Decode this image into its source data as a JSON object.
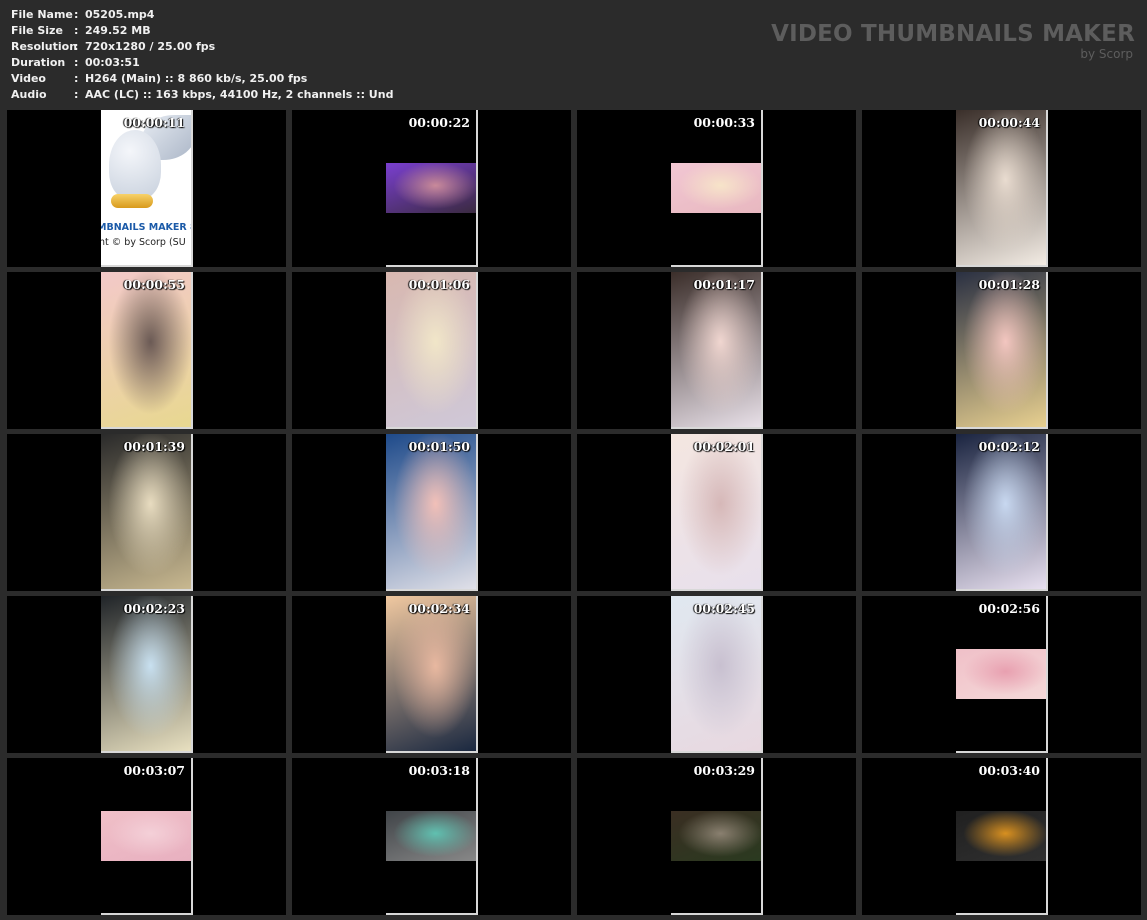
{
  "info": [
    {
      "key": "File Name",
      "value": "05205.mp4"
    },
    {
      "key": "File Size",
      "value": "249.52 MB"
    },
    {
      "key": "Resolution",
      "value": "720x1280 / 25.00 fps"
    },
    {
      "key": "Duration",
      "value": "00:03:51"
    },
    {
      "key": "Video",
      "value": "H264 (Main) :: 8 860 kb/s, 25.00 fps"
    },
    {
      "key": "Audio",
      "value": "AAC (LC) :: 163 kbps, 44100 Hz, 2 channels :: Und"
    }
  ],
  "separator": ":",
  "logo": {
    "title": "VIDEO THUMBNAILS MAKER",
    "subtitle": "by Scorp"
  },
  "owl_frame": {
    "line1": "MBNAILS MAKER 8",
    "line2": "nt © by Scorp (SU"
  },
  "thumbnails": [
    {
      "time": "00:00:11",
      "kind": "owl"
    },
    {
      "time": "00:00:22",
      "kind": "banner",
      "colors": [
        "#7a3fd0",
        "#c98a9a",
        "#3a2a40"
      ]
    },
    {
      "time": "00:00:33",
      "kind": "banner",
      "colors": [
        "#f2c7d3",
        "#f7e4c9",
        "#e8b8c0"
      ]
    },
    {
      "time": "00:00:44",
      "kind": "full",
      "colors": [
        "#3a2f2a",
        "#e9dcd0",
        "#f3ece4"
      ]
    },
    {
      "time": "00:00:55",
      "kind": "full",
      "colors": [
        "#f3c9c9",
        "#6b5a55",
        "#e8d890"
      ]
    },
    {
      "time": "00:01:06",
      "kind": "full",
      "colors": [
        "#d8b8b0",
        "#f1e6c8",
        "#cfc8d8"
      ]
    },
    {
      "time": "00:01:17",
      "kind": "full",
      "colors": [
        "#3b2e2a",
        "#f0d6d0",
        "#e8e0e8"
      ]
    },
    {
      "time": "00:01:28",
      "kind": "full",
      "colors": [
        "#2a3042",
        "#f3c6c0",
        "#e8d090"
      ]
    },
    {
      "time": "00:01:39",
      "kind": "full",
      "colors": [
        "#2a2a2a",
        "#e8dcc0",
        "#c8b890"
      ]
    },
    {
      "time": "00:01:50",
      "kind": "full",
      "colors": [
        "#1e4a8a",
        "#f2c0b8",
        "#e0e0e8"
      ]
    },
    {
      "time": "00:02:01",
      "kind": "full",
      "colors": [
        "#f4e6e0",
        "#d6b8b8",
        "#e8e0ec"
      ]
    },
    {
      "time": "00:02:12",
      "kind": "full",
      "colors": [
        "#1a2440",
        "#c8d8f0",
        "#e8e0f0"
      ]
    },
    {
      "time": "00:02:23",
      "kind": "full",
      "colors": [
        "#202428",
        "#c8e0f0",
        "#e8e0c0"
      ]
    },
    {
      "time": "00:02:34",
      "kind": "full",
      "colors": [
        "#f0c8a0",
        "#e8b8a0",
        "#1a2840"
      ]
    },
    {
      "time": "00:02:45",
      "kind": "full",
      "colors": [
        "#e0e8f0",
        "#c8c0d0",
        "#e8d8e0"
      ]
    },
    {
      "time": "00:02:56",
      "kind": "banner",
      "colors": [
        "#f0c0c8",
        "#e8a0b0",
        "#f4d8d8"
      ]
    },
    {
      "time": "00:03:07",
      "kind": "banner",
      "colors": [
        "#f0c0c8",
        "#f4d0d8",
        "#e8b0c0"
      ]
    },
    {
      "time": "00:03:18",
      "kind": "banner",
      "colors": [
        "#404448",
        "#60c0b0",
        "#888888"
      ]
    },
    {
      "time": "00:03:29",
      "kind": "banner",
      "colors": [
        "#3a2e22",
        "#8a8070",
        "#2a3a20"
      ]
    },
    {
      "time": "00:03:40",
      "kind": "banner",
      "colors": [
        "#202020",
        "#d89020",
        "#303030"
      ]
    }
  ]
}
